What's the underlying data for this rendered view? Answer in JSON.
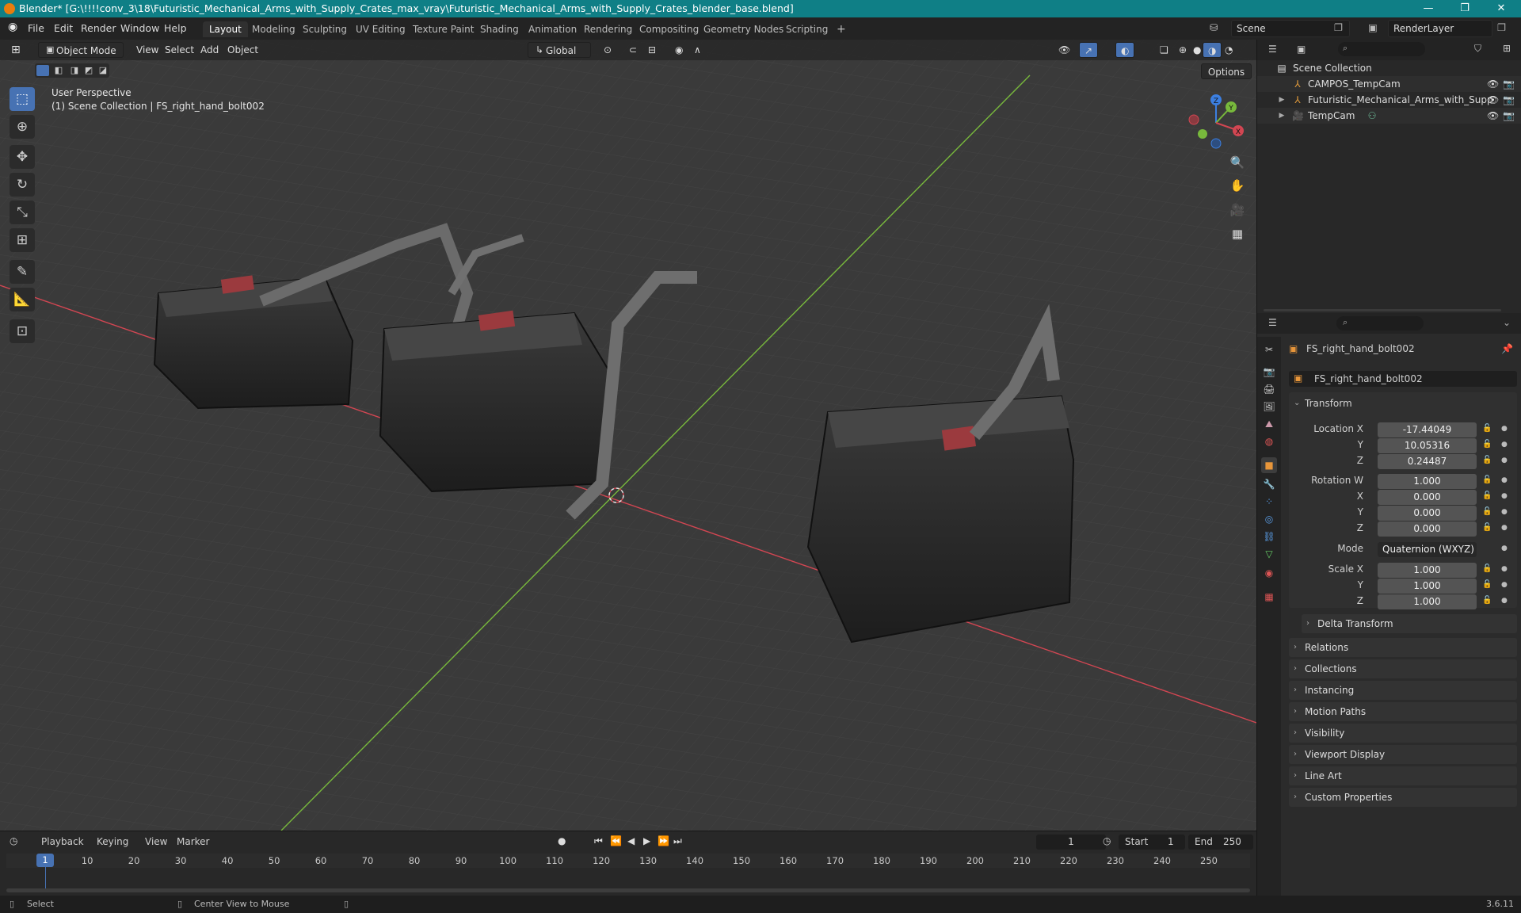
{
  "window": {
    "title": "Blender* [G:\\!!!!conv_3\\18\\Futuristic_Mechanical_Arms_with_Supply_Crates_max_vray\\Futuristic_Mechanical_Arms_with_Supply_Crates_blender_base.blend]",
    "minimize": "—",
    "maximize": "❐",
    "close": "✕"
  },
  "menu": [
    "File",
    "Edit",
    "Render",
    "Window",
    "Help"
  ],
  "workspaces": [
    "Layout",
    "Modeling",
    "Sculpting",
    "UV Editing",
    "Texture Paint",
    "Shading",
    "Animation",
    "Rendering",
    "Compositing",
    "Geometry Nodes",
    "Scripting",
    "+"
  ],
  "scene": {
    "name": "Scene",
    "view_layer": "RenderLayer"
  },
  "viewport": {
    "mode": "Object Mode",
    "menus": [
      "View",
      "Select",
      "Add",
      "Object"
    ],
    "orientation": "Global",
    "options_label": "Options",
    "perspective": "User Perspective",
    "collection_info": "(1) Scene Collection | FS_right_hand_bolt002",
    "gizmo": {
      "z": "Z",
      "y": "Y",
      "x": "X"
    }
  },
  "outliner": {
    "root": "Scene Collection",
    "items": [
      {
        "name": "CAMPOS_TempCam"
      },
      {
        "name": "Futuristic_Mechanical_Arms_with_Supp"
      },
      {
        "name": "TempCam"
      }
    ]
  },
  "properties": {
    "object_name": "FS_right_hand_bolt002",
    "data_name": "FS_right_hand_bolt002",
    "transform_title": "Transform",
    "location": {
      "label": "Location X",
      "x": "-17.44049",
      "y": "10.05316",
      "z": "0.24487"
    },
    "rotation": {
      "label": "Rotation W",
      "w": "1.000",
      "x": "0.000",
      "y": "0.000",
      "z": "0.000"
    },
    "mode": {
      "label": "Mode",
      "value": "Quaternion (WXYZ)"
    },
    "scale": {
      "label": "Scale X",
      "x": "1.000",
      "y": "1.000",
      "z": "1.000"
    },
    "axis_labels": {
      "x": "X",
      "y": "Y",
      "z": "Z"
    },
    "delta": "Delta Transform",
    "panels": [
      "Relations",
      "Collections",
      "Instancing",
      "Motion Paths",
      "Visibility",
      "Viewport Display",
      "Line Art",
      "Custom Properties"
    ]
  },
  "timeline": {
    "menus": [
      "Playback",
      "Keying",
      "View",
      "Marker"
    ],
    "current_frame": "1",
    "start_label": "Start",
    "start": "1",
    "end_label": "End",
    "end": "250",
    "ticks": [
      "1",
      "10",
      "20",
      "30",
      "40",
      "50",
      "60",
      "70",
      "80",
      "90",
      "100",
      "110",
      "120",
      "130",
      "140",
      "150",
      "160",
      "170",
      "180",
      "190",
      "200",
      "210",
      "220",
      "230",
      "240",
      "250"
    ]
  },
  "status": {
    "left": "Select",
    "middle": "Center View to Mouse",
    "version": "3.6.11"
  },
  "colors": {
    "accent": "#4772b3",
    "titlebar": "#0f7f86",
    "x_axis": "#d24652",
    "y_axis": "#78b93c",
    "z_axis": "#3c7fe0"
  }
}
